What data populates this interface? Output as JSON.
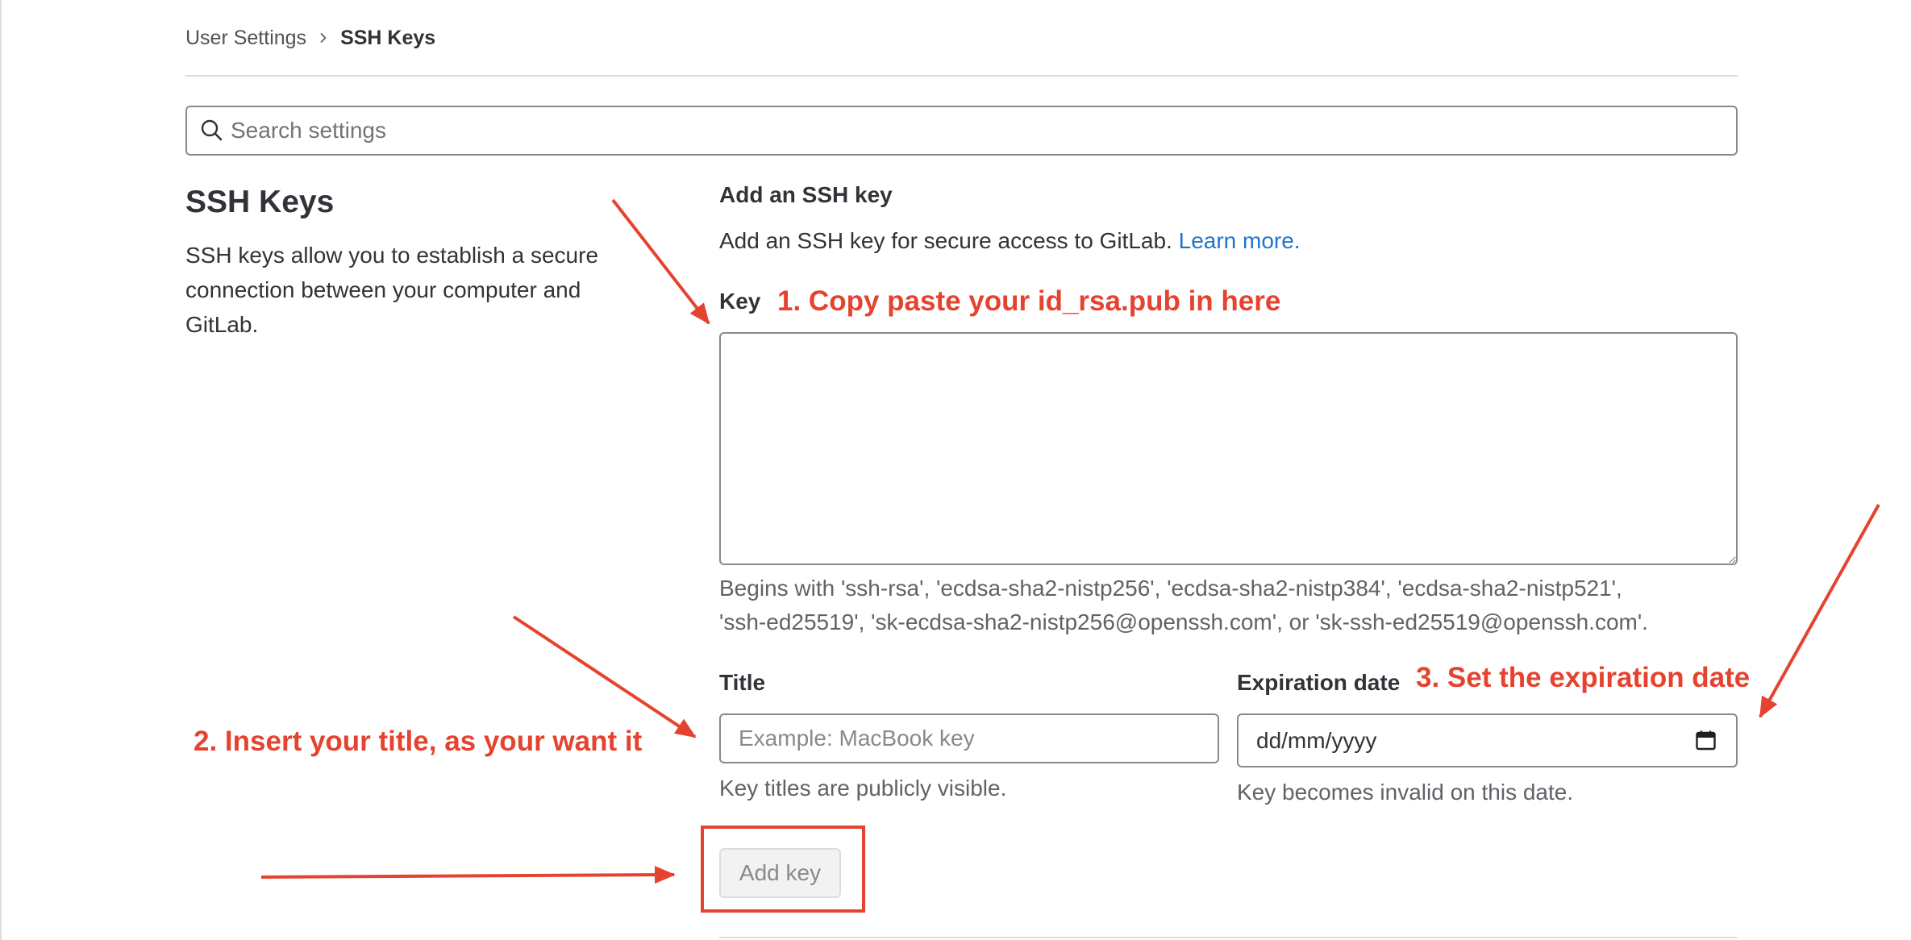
{
  "breadcrumb": {
    "parent": "User Settings",
    "current": "SSH Keys"
  },
  "search": {
    "placeholder": "Search settings",
    "value": ""
  },
  "section": {
    "title": "SSH Keys",
    "description": "SSH keys allow you to establish a secure\nconnection between your computer and\nGitLab."
  },
  "form": {
    "heading": "Add an SSH key",
    "intro": "Add an SSH key for secure access to GitLab.",
    "learn_more_label": "Learn more.",
    "key": {
      "label": "Key",
      "value": "",
      "help": "Begins with 'ssh-rsa', 'ecdsa-sha2-nistp256', 'ecdsa-sha2-nistp384', 'ecdsa-sha2-nistp521',\n'ssh-ed25519', 'sk-ecdsa-sha2-nistp256@openssh.com', or 'sk-ssh-ed25519@openssh.com'."
    },
    "title": {
      "label": "Title",
      "placeholder": "Example: MacBook key",
      "value": "",
      "help": "Key titles are publicly visible."
    },
    "expiration": {
      "label": "Expiration date",
      "value": "dd/mm/yyyy",
      "help": "Key becomes invalid on this date."
    },
    "submit": {
      "label": "Add key",
      "disabled": true
    }
  },
  "annotations": {
    "key": "1. Copy paste your id_rsa.pub in here",
    "title": "2. Insert your title, as your want it",
    "expiration": "3. Set the expiration date"
  },
  "icons": {
    "breadcrumb_separator": "chevron-right-icon",
    "search": "search-icon",
    "calendar": "calendar-icon"
  },
  "colors": {
    "annotation": "#e5432f",
    "link": "#1f75cb",
    "text": "#333238",
    "muted": "#626168"
  }
}
